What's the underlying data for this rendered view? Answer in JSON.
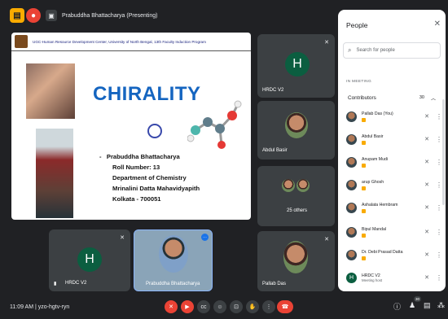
{
  "top": {
    "presenting_text": "Prabuddha Bhattacharya (Presenting)"
  },
  "slide": {
    "header": "UGC-Human Resource Development Center, University of North Bengal, 13th Faculty Induction Program",
    "title": "CHIRALITY",
    "name": "Prabuddha Bhattacharya",
    "roll": "Roll Number: 13",
    "dept": "Department of Chemistry",
    "college": "Mrinalini Datta Mahavidyapith",
    "city": "Kolkata - 700051",
    "bullet": "-"
  },
  "tiles": {
    "hrdc_right": "HRDC V2",
    "abdul": "Abdul Basir",
    "others": "25 others",
    "hrdc_bottom": "HRDC V2",
    "prabuddha": "Prabuddha Bhattacharya",
    "pallab": "Pallab Das",
    "avatar_letter": "H"
  },
  "people": {
    "title": "People",
    "search_placeholder": "Search for people",
    "in_meeting": "IN MEETING",
    "contributors": "Contributors",
    "contributors_count": "30",
    "list": [
      {
        "name": "Pallab Das (You)"
      },
      {
        "name": "Abdul Basir"
      },
      {
        "name": "Anupam Mudi"
      },
      {
        "name": "arup Ghosh"
      },
      {
        "name": "Ashalata Hembram"
      },
      {
        "name": "Bipul Mandal"
      },
      {
        "name": "Dr. Debi Prasad Datta"
      },
      {
        "name": "HRDC V2",
        "sub": "Meeting host"
      }
    ]
  },
  "bottom": {
    "meeting_info": "11:09 AM  |  yzo-hgtv-ryn",
    "participants_badge": "30"
  },
  "colors": {
    "background": "#202124",
    "end_call": "#ea4335",
    "avatar": "#0b5e40",
    "slide_title": "#1565c0"
  }
}
